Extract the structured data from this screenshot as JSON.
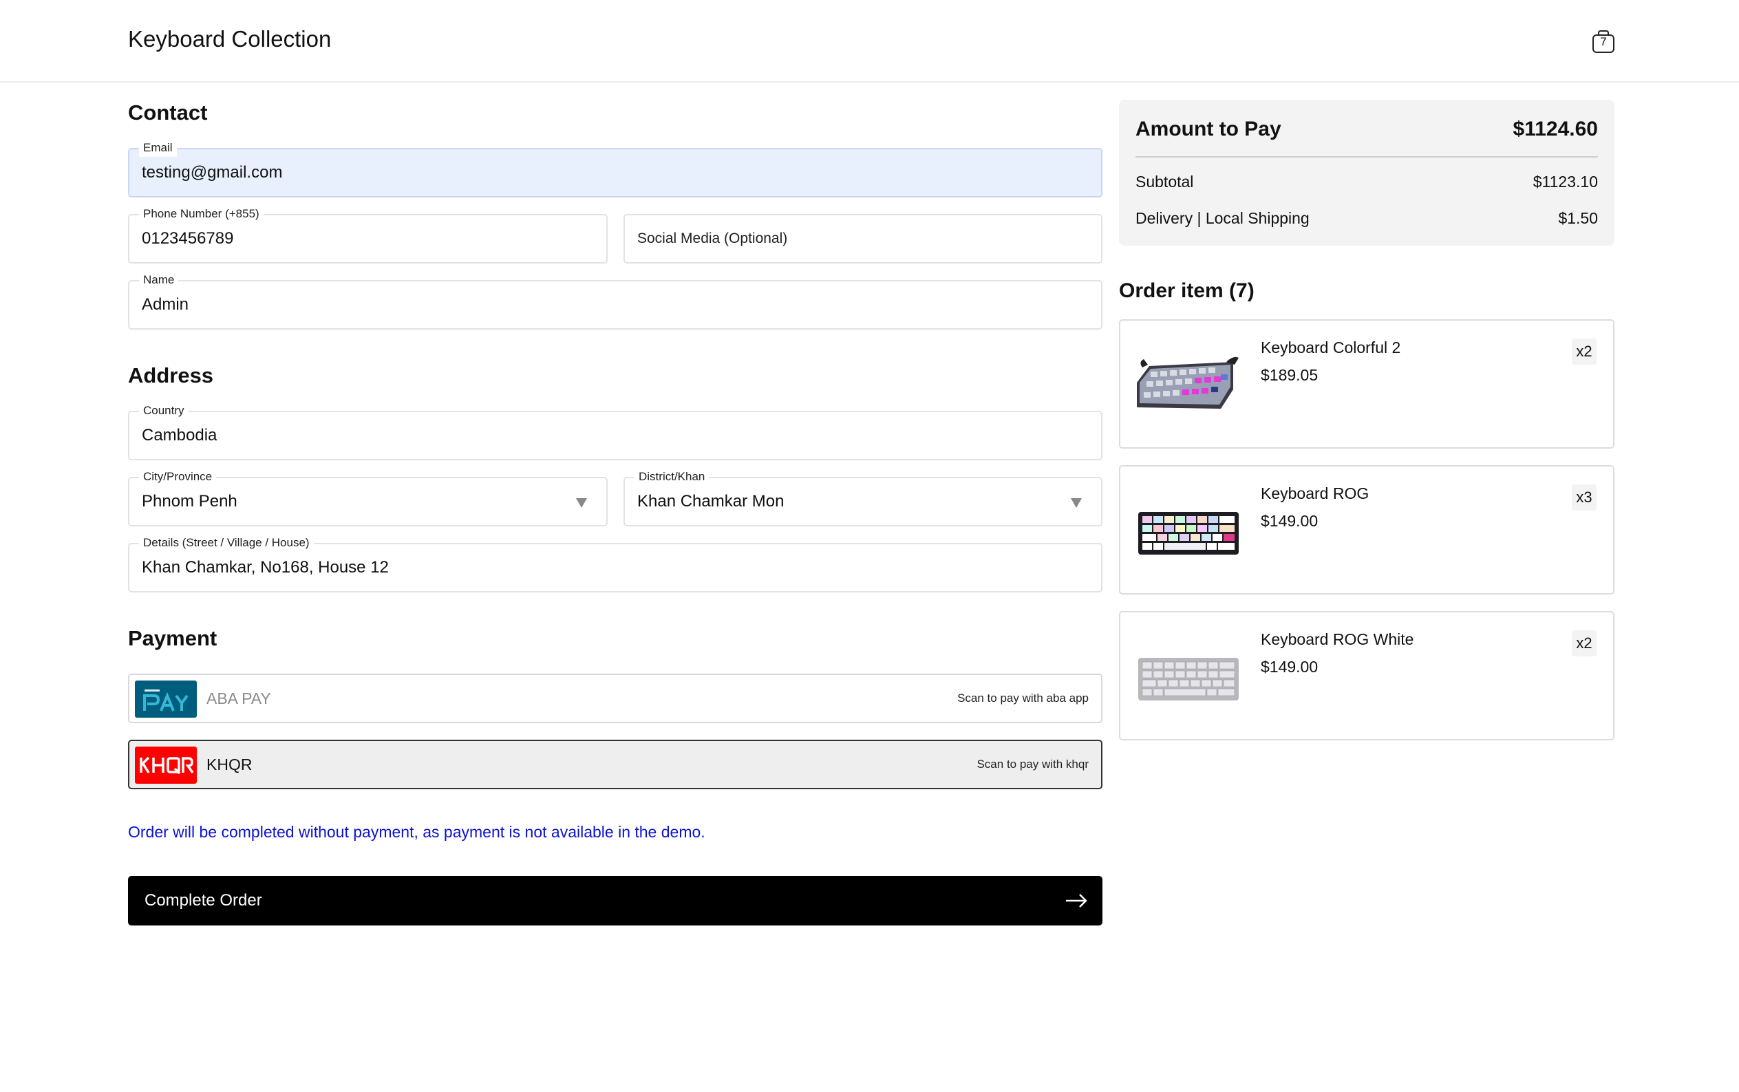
{
  "header": {
    "brand": "Keyboard Collection",
    "cart_count": "7"
  },
  "contact": {
    "title": "Contact",
    "email": {
      "label": "Email",
      "value": "testing@gmail.com"
    },
    "phone": {
      "label": "Phone Number (+855)",
      "value": "0123456789"
    },
    "social": {
      "placeholder": "Social Media (Optional)"
    },
    "name": {
      "label": "Name",
      "value": "Admin"
    }
  },
  "address": {
    "title": "Address",
    "country": {
      "label": "Country",
      "value": "Cambodia"
    },
    "city": {
      "label": "City/Province",
      "value": "Phnom Penh"
    },
    "district": {
      "label": "District/Khan",
      "value": "Khan Chamkar Mon"
    },
    "details": {
      "label": "Details (Street / Village / House)",
      "value": "Khan Chamkar, No168, House 12"
    }
  },
  "payment": {
    "title": "Payment",
    "options": [
      {
        "name": "ABA PAY",
        "note": "Scan to pay with aba app",
        "selected": false,
        "logo_color": "#005d7e"
      },
      {
        "name": "KHQR",
        "note": "Scan to pay with khqr",
        "selected": true,
        "logo_color": "#ff0000"
      }
    ],
    "notice": "Order will be completed without payment, as payment is not available in the demo.",
    "notice_color": "#0b12d4"
  },
  "complete_label": "Complete Order",
  "summary": {
    "amount_label": "Amount to Pay",
    "amount_value": "$1124.60",
    "subtotal_label": "Subtotal",
    "subtotal_value": "$1123.10",
    "delivery_label": "Delivery | Local Shipping",
    "delivery_value": "$1.50"
  },
  "order": {
    "title": "Order item (7)",
    "items": [
      {
        "name": "Keyboard Colorful 2",
        "price": "$189.05",
        "qty": "x2"
      },
      {
        "name": "Keyboard ROG",
        "price": "$149.00",
        "qty": "x3"
      },
      {
        "name": "Keyboard ROG White",
        "price": "$149.00",
        "qty": "x2"
      }
    ]
  }
}
